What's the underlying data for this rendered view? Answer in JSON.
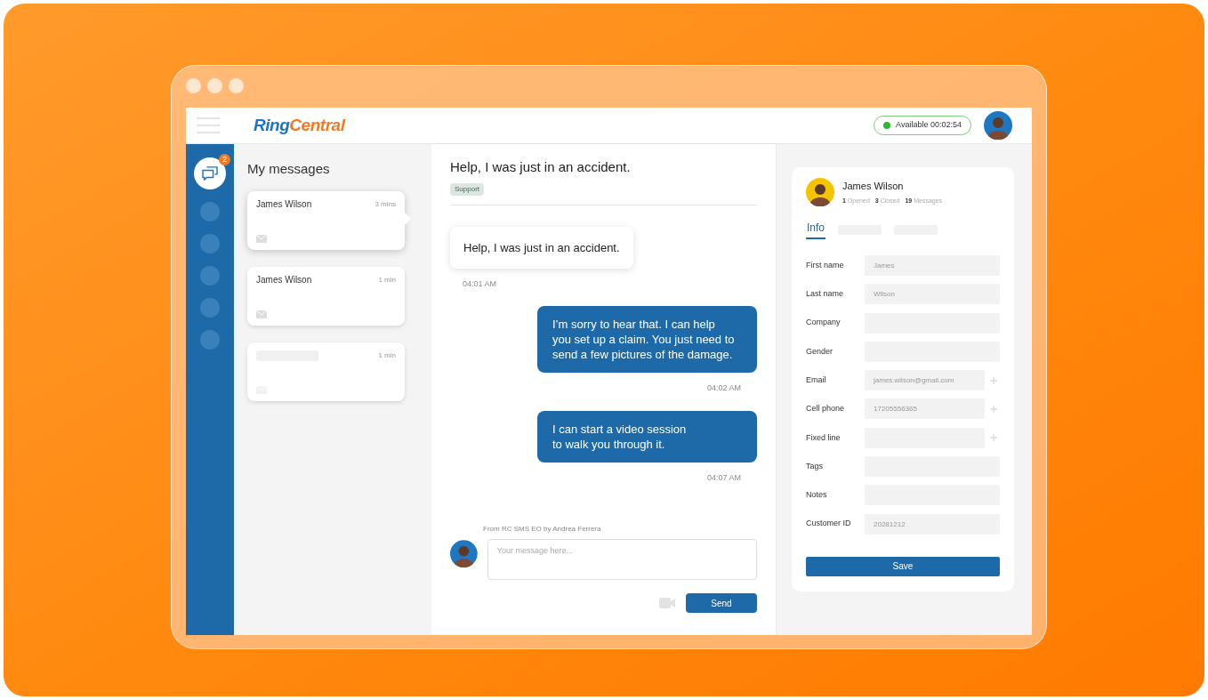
{
  "logo": {
    "parts": [
      {
        "text": "Ring",
        "color": "#1d74c4"
      },
      {
        "text": "Central",
        "color": "#f47920"
      }
    ]
  },
  "status": {
    "label": "Available 00:02:54",
    "online": true
  },
  "sidebar": {
    "items": [
      {
        "selected": true,
        "badge": "2"
      },
      {
        "selected": false
      },
      {
        "selected": false
      },
      {
        "selected": false
      },
      {
        "selected": false
      },
      {
        "selected": false
      }
    ]
  },
  "messages_panel": {
    "title": "My messages",
    "conversations": [
      {
        "name": "James Wilson",
        "time": "3 mins",
        "selected": true
      },
      {
        "name": "James Wilson",
        "time": "1 min",
        "selected": false
      },
      {
        "time": "1 min",
        "selected": false
      }
    ]
  },
  "chat": {
    "title": "Help, I was just in an accident.",
    "tag": "Support",
    "messages": [
      {
        "kind": "incoming",
        "text": "Help, I was just in an accident.",
        "time": "04:01 AM"
      },
      {
        "kind": "outgoing",
        "text": "I’m sorry to hear that. I can help you set up a claim. You just need to send a few pictures of the damage.",
        "time": "04:02 AM"
      },
      {
        "kind": "outgoing",
        "text": "I can start a video session to walk you through it.",
        "time": "04:07 AM"
      }
    ],
    "from": "From RC SMS EO by Andrea Ferrera",
    "placeholder": "Your message here...",
    "send": "Send"
  },
  "contact": {
    "name": "James Wilson",
    "stats": [
      {
        "count": "1",
        "label": "Opened"
      },
      {
        "count": "3",
        "label": "Closed"
      },
      {
        "count": "19",
        "label": "Messages"
      }
    ],
    "tabs": [
      {
        "label": "Info",
        "selected": true
      },
      {
        "selected": false
      },
      {
        "selected": false
      }
    ],
    "fields": [
      {
        "kind": "plain",
        "label": "First name",
        "value": "James"
      },
      {
        "kind": "plain",
        "label": "Last name",
        "value": "Wilson"
      },
      {
        "kind": "plain",
        "label": "Company"
      },
      {
        "kind": "plain",
        "label": "Gender"
      },
      {
        "kind": "addable",
        "label": "Email",
        "value": "james.wilson@gmail.com"
      },
      {
        "kind": "addable",
        "label": "Cell phone",
        "value": "17205556365"
      },
      {
        "kind": "addable",
        "label": "Fixed line"
      },
      {
        "kind": "plain",
        "label": "Tags"
      },
      {
        "kind": "plain",
        "label": "Notes"
      },
      {
        "kind": "plain",
        "label": "Customer ID",
        "value": "20281212"
      }
    ],
    "save": "Save"
  }
}
